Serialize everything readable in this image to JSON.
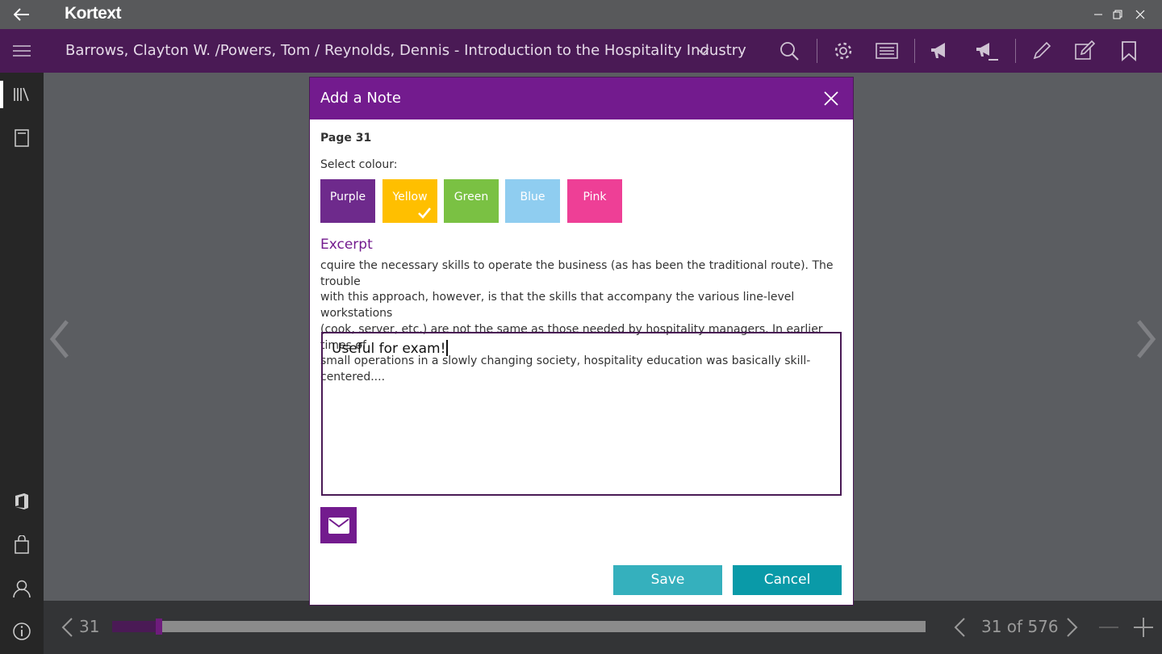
{
  "window": {
    "brand": "Kortext"
  },
  "toolbar": {
    "book_title": "Barrows, Clayton W. /Powers, Tom / Reynolds, Dennis - Introduction to the Hospitality Industry"
  },
  "modal": {
    "title": "Add a Note",
    "page": "Page 31",
    "colour_label": "Select colour:",
    "colours": [
      {
        "label": "Purple",
        "color": "#6e2a8c"
      },
      {
        "label": "Yellow",
        "color": "#ffbf00",
        "selected": true
      },
      {
        "label": "Green",
        "color": "#7ac143"
      },
      {
        "label": "Blue",
        "color": "#8fcdf0"
      },
      {
        "label": "Pink",
        "color": "#ee3f96"
      }
    ],
    "excerpt_heading": "Excerpt",
    "excerpt_lines": [
      "cquire the necessary skills to operate the business (as has been the traditional route). The trouble",
      "with this approach, however, is that the skills that accompany the various line-level workstations",
      "(cook, server, etc.) are not the same as those needed by hospitality managers. In earlier times of",
      "small operations in a slowly changing society, hospitality education was basically skill-centered...."
    ],
    "note_text": "Useful for exam!",
    "save_label": "Save",
    "cancel_label": "Cancel"
  },
  "bottombar": {
    "current_page": "31",
    "page_count_text": "31 of 576",
    "progress_fraction": 0.054
  },
  "colors": {
    "accent_purple": "#731b8e",
    "toolbar_purple": "#4a1a55",
    "teal": "#0a9aa8"
  }
}
